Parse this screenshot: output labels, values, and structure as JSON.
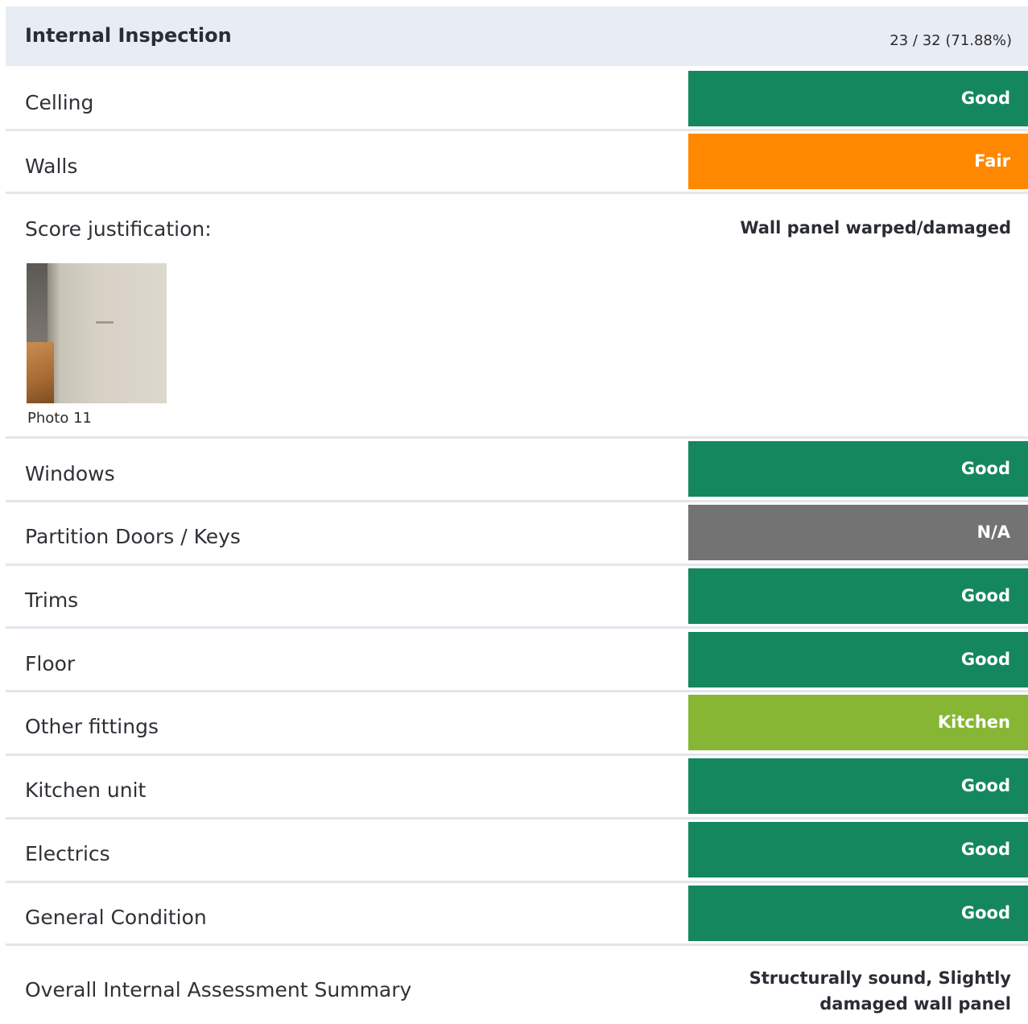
{
  "header": {
    "title": "Internal Inspection",
    "score": "23 / 32 (71.88%)"
  },
  "rows": [
    {
      "label": "Celling",
      "status": "Good",
      "color": "#15875e"
    },
    {
      "label": "Walls",
      "status": "Fair",
      "color": "#ff8800"
    }
  ],
  "justification": {
    "label": "Score justification:",
    "value": "Wall panel warped/damaged",
    "photo_caption": "Photo 11"
  },
  "rows2": [
    {
      "label": "Windows",
      "status": "Good",
      "color": "#15875e"
    },
    {
      "label": "Partition Doors / Keys",
      "status": "N/A",
      "color": "#737373"
    },
    {
      "label": "Trims",
      "status": "Good",
      "color": "#15875e"
    },
    {
      "label": "Floor",
      "status": "Good",
      "color": "#15875e"
    },
    {
      "label": "Other fittings",
      "status": "Kitchen",
      "color": "#86b633"
    },
    {
      "label": "Kitchen unit",
      "status": "Good",
      "color": "#15875e"
    },
    {
      "label": "Electrics",
      "status": "Good",
      "color": "#15875e"
    },
    {
      "label": "General Condition",
      "status": "Good",
      "color": "#15875e"
    }
  ],
  "summary": {
    "label": "Overall Internal Assessment Summary",
    "value_line1": "Structurally sound, Slightly",
    "value_line2": "damaged wall panel"
  }
}
